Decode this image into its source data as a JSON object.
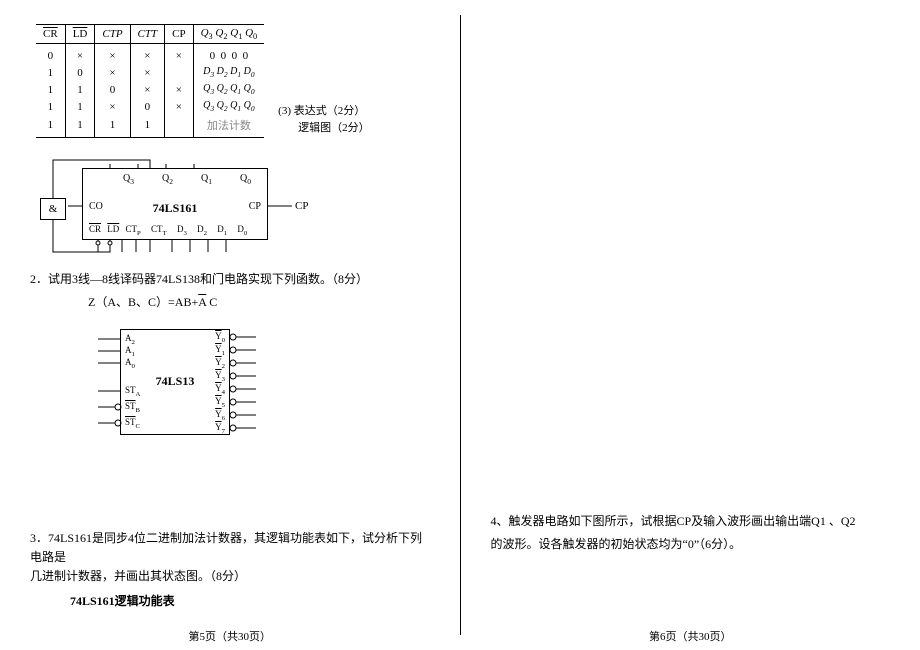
{
  "truthTable": {
    "headers": {
      "cr": "CR",
      "ld": "LD",
      "ctp": "CTP",
      "ctt": "CTT",
      "cp": "CP",
      "q": "Q3 Q2 Q1 Q0"
    },
    "rows": [
      {
        "cr": "0",
        "ld": "×",
        "ctp": "×",
        "ctt": "×",
        "cp": "×",
        "q": "0  0  0  0"
      },
      {
        "cr": "1",
        "ld": "0",
        "ctp": "×",
        "ctt": "×",
        "cp": "",
        "q": "D3 D2 D1 D0"
      },
      {
        "cr": "1",
        "ld": "1",
        "ctp": "0",
        "ctt": "×",
        "cp": "×",
        "q": "Q3 Q2 Q1 Q0"
      },
      {
        "cr": "1",
        "ld": "1",
        "ctp": "×",
        "ctt": "0",
        "cp": "×",
        "q": "Q3 Q2 Q1 Q0"
      },
      {
        "cr": "1",
        "ld": "1",
        "ctp": "1",
        "ctt": "1",
        "cp": "",
        "q": "加法计数"
      }
    ]
  },
  "sidenote": {
    "line1": "(3)  表达式（2分）",
    "line2": "逻辑图（2分）"
  },
  "gate": {
    "symbol": "&"
  },
  "chip161": {
    "name": "74LS161",
    "co": "CO",
    "cp": "CP",
    "cp_ext": "CP",
    "q0": "Q0",
    "q1": "Q1",
    "q2": "Q2",
    "q3": "Q3",
    "b_cr": "CR",
    "b_ld": "LD",
    "b_ctp": "CTP",
    "b_ctt": "CTT",
    "b_d3": "D3",
    "b_d2": "D2",
    "b_d1": "D1",
    "b_d0": "D0"
  },
  "prob2": {
    "text": "2．试用3线—8线译码器74LS138和门电路实现下列函数。（8分）",
    "func_plain": "Z（A、B、C）=AB+",
    "func_bar": "A",
    "func_tail": " C"
  },
  "chip138": {
    "name": "74LS13",
    "a2": "A2",
    "a1": "A1",
    "a0": "A0",
    "sta": "STA",
    "stb": "STB",
    "stc": "STC",
    "y0": "Y0",
    "y1": "Y1",
    "y2": "Y2",
    "y3": "Y3",
    "y4": "Y4",
    "y5": "Y5",
    "y6": "Y6",
    "y7": "Y7"
  },
  "prob3": {
    "line1a": "3．74LS161是同步4位二进制加法计数器，其逻辑功能表如下，试分析下列电路是",
    "line1b": "几进制计数器，并画出其状态图。（8分）",
    "title": "74LS161逻辑功能表"
  },
  "prob4": {
    "line1": "4、触发器电路如下图所示，试根据CP及输入波形画出输出端Q1 、Q2",
    "line2a": "的波形。设各触发器的初始状态均为“0”（6分）",
    "line2b": "。"
  },
  "footer": {
    "page5": "第5页（共30页）",
    "page6": "第6页（共30页）"
  }
}
